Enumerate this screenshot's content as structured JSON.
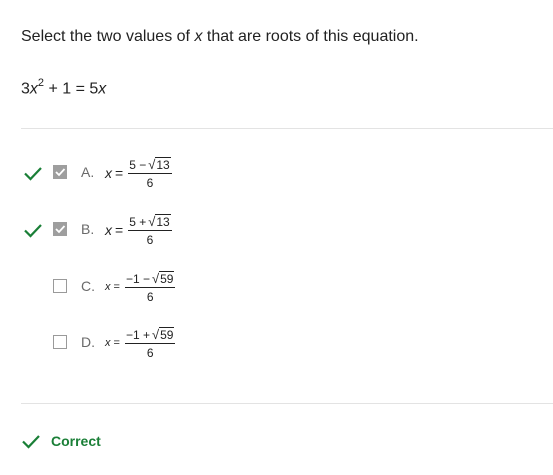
{
  "question": {
    "prefix": "Select the two values of",
    "variable": "x",
    "suffix": "that are roots of this equation."
  },
  "equation": {
    "coef": "3",
    "variable": "x",
    "exponent": "2",
    "rest": " + 1 = 5",
    "rhs_variable": "x"
  },
  "options": [
    {
      "letter": "A.",
      "var": "x",
      "eq": "=",
      "num_left": "5 −",
      "radicand": "13",
      "den": "6",
      "checked": true,
      "correct_marked": true
    },
    {
      "letter": "B.",
      "var": "x",
      "eq": "=",
      "num_left": "5 +",
      "radicand": "13",
      "den": "6",
      "checked": true,
      "correct_marked": true
    },
    {
      "letter": "C.",
      "var": "x",
      "eq": "=",
      "num_left": "−1 −",
      "radicand": "59",
      "den": "6",
      "checked": false,
      "correct_marked": false
    },
    {
      "letter": "D.",
      "var": "x",
      "eq": "=",
      "num_left": "−1 +",
      "radicand": "59",
      "den": "6",
      "checked": false,
      "correct_marked": false
    }
  ],
  "result": {
    "label": "Correct",
    "icon": "checkmark-icon"
  },
  "colors": {
    "correct_green": "#1a7f37",
    "checkbox_checked": "#9e9e9e",
    "divider": "#e3e3e3"
  }
}
